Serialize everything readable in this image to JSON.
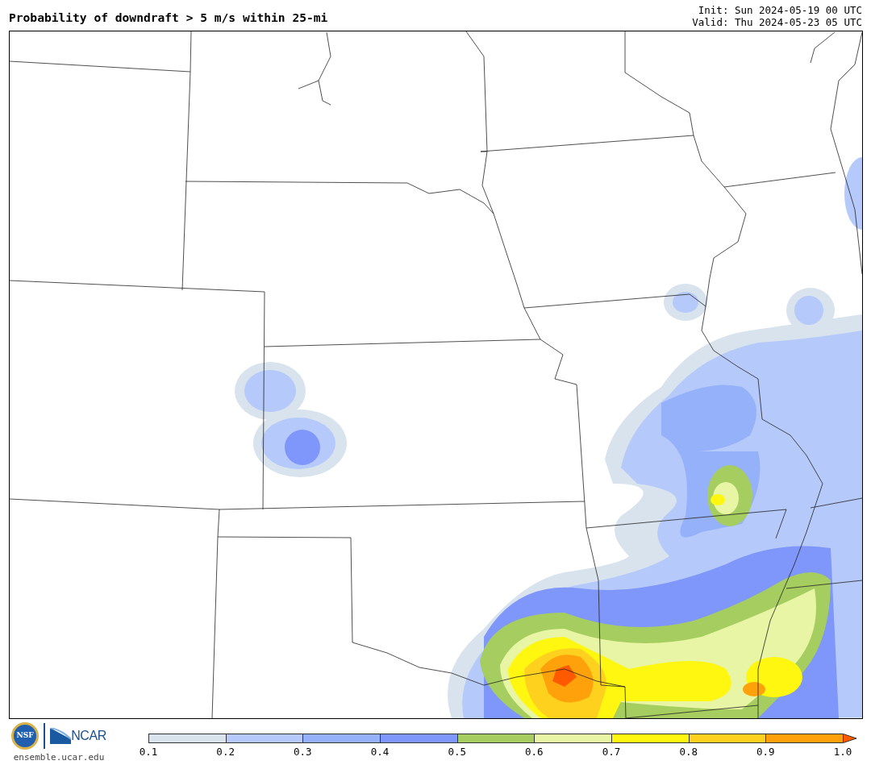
{
  "title": "Probability of downdraft > 5 m/s within 25-mi",
  "init": "Init: Sun 2024-05-19 00 UTC",
  "valid": "Valid: Thu 2024-05-23 05 UTC",
  "colorbar": {
    "segments": [
      {
        "color": "#d8e3ee",
        "kind": "band"
      },
      {
        "color": "#b5c9fb",
        "kind": "band"
      },
      {
        "color": "#95b1fa",
        "kind": "band"
      },
      {
        "color": "#7f96fb",
        "kind": "band"
      },
      {
        "color": "#a6cd5f",
        "kind": "band"
      },
      {
        "color": "#e8f5a4",
        "kind": "band"
      },
      {
        "color": "#fff70f",
        "kind": "band"
      },
      {
        "color": "#ffd11f",
        "kind": "band"
      },
      {
        "color": "#ffa10b",
        "kind": "band"
      },
      {
        "color": "#ff5a00",
        "kind": "arrow"
      }
    ],
    "ticks": [
      "0.1",
      "0.2",
      "0.3",
      "0.4",
      "0.5",
      "0.6",
      "0.7",
      "0.8",
      "0.9",
      "1.0"
    ]
  },
  "logos": {
    "nsf": "NSF",
    "ncar": "NCAR"
  },
  "url": "ensemble.ucar.edu"
}
